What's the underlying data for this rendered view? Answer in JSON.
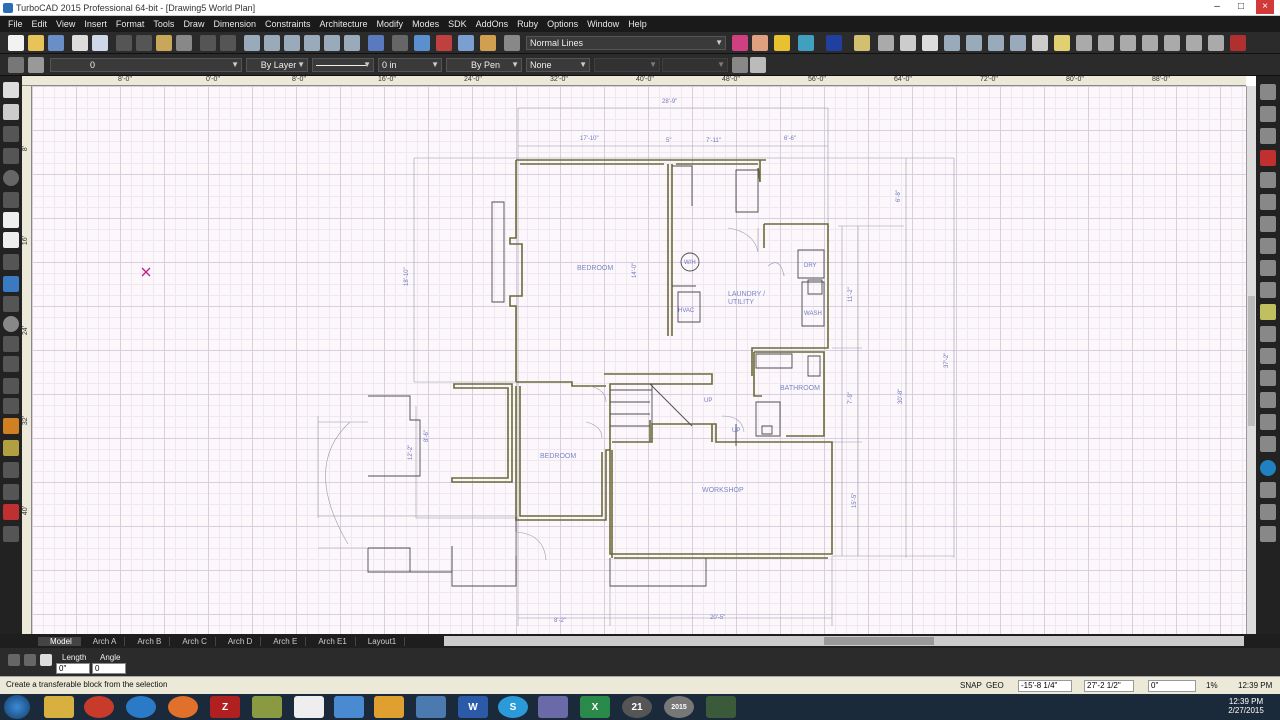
{
  "window": {
    "title": "TurboCAD 2015 Professional 64-bit - [Drawing5 World Plan]"
  },
  "menu": [
    "File",
    "Edit",
    "View",
    "Insert",
    "Format",
    "Tools",
    "Draw",
    "Dimension",
    "Constraints",
    "Architecture",
    "Modify",
    "Modes",
    "SDK",
    "AddOns",
    "Ruby",
    "Options",
    "Window",
    "Help"
  ],
  "toolbar": {
    "line_style": "Normal Lines"
  },
  "properties": {
    "layer": "0",
    "color": "By Layer",
    "thickness": "0 in",
    "pen": "By Pen",
    "fill": "None"
  },
  "ruler_top": [
    "8'-0\"",
    "0'-0\"",
    "8'-0\"",
    "16'-0\"",
    "24'-0\"",
    "32'-0\"",
    "40'-0\"",
    "48'-0\"",
    "56'-0\"",
    "64'-0\"",
    "72'-0\"",
    "80'-0\"",
    "88'-0\""
  ],
  "ruler_left": [
    "8'",
    "16'",
    "24'",
    "32'",
    "40'"
  ],
  "plan": {
    "rooms": [
      "BEDROOM",
      "LAUNDRY /",
      "UTILITY",
      "BATHROOM",
      "BEDROOM",
      "WORKSHOP"
    ],
    "fixtures": [
      "DRY",
      "WASH",
      "HVAC",
      "W/H",
      "UP",
      "UP"
    ],
    "dimensions": [
      "28'-9\"",
      "17'-10\"",
      "5\"",
      "7'-11\"",
      "6'-6\"",
      "6'-8\"",
      "18'-10\"",
      "14'-0\"",
      "11'-2\"",
      "7'-9\"",
      "30'-8\"",
      "37'-2\"",
      "8'-6\"",
      "12'-2\"",
      "15'-5\"",
      "8'-2\"",
      "20'-5\""
    ]
  },
  "layout_tabs": [
    "Model",
    "Arch A",
    "Arch B",
    "Arch C",
    "Arch D",
    "Arch E",
    "Arch E1",
    "Layout1"
  ],
  "inspector": {
    "length_label": "Length",
    "angle_label": "Angle",
    "length_value": "0\"",
    "angle_value": "0"
  },
  "status": {
    "message": "Create a transferable block from the selection",
    "snap": "SNAP",
    "geo": "GEO",
    "x": "-15'-8 1/4\"",
    "y": "27'-2 1/2\"",
    "z": "0\"",
    "zoom": "1%",
    "time": "12:39 PM"
  },
  "taskbar": {
    "time": "12:39 PM",
    "date": "2/27/2015",
    "apps": [
      "explorer",
      "chrome",
      "ie",
      "firefox",
      "filezilla",
      "app",
      "metro",
      "app2",
      "app3",
      "app4",
      "word",
      "skype",
      "app5",
      "excel",
      "app6",
      "app7",
      "app8"
    ],
    "labels": {
      "filezilla": "Z",
      "word": "W",
      "skype": "S",
      "excel": "X",
      "app6": "21",
      "app7": "2015"
    }
  }
}
